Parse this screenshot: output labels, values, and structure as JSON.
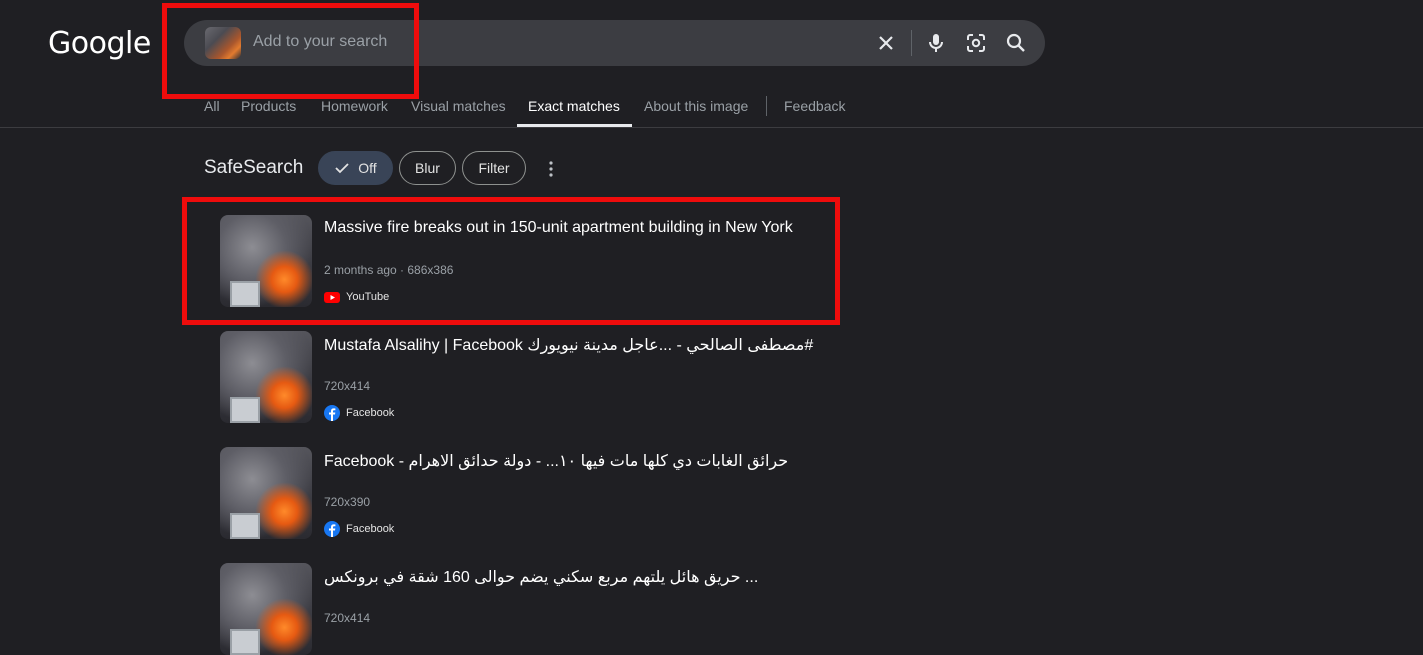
{
  "logo": "Google",
  "search": {
    "placeholder": "Add to your search"
  },
  "tabs": [
    {
      "label": "All"
    },
    {
      "label": "Products"
    },
    {
      "label": "Homework"
    },
    {
      "label": "Visual matches"
    },
    {
      "label": "Exact matches"
    },
    {
      "label": "About this image"
    },
    {
      "label": "Feedback"
    }
  ],
  "active_tab": "Exact matches",
  "safesearch": {
    "label": "SafeSearch",
    "options": [
      {
        "label": "Off",
        "selected": true
      },
      {
        "label": "Blur",
        "selected": false
      },
      {
        "label": "Filter",
        "selected": false
      }
    ]
  },
  "results": [
    {
      "title": "Massive fire breaks out in 150-unit apartment building in New York",
      "meta": "2 months ago · 686x386",
      "source": "YouTube",
      "source_icon": "youtube-icon"
    },
    {
      "title": "Mustafa Alsalihy | Facebook مصطفى الصالحي - ...عاجل مدينة نيويورك#",
      "meta": "720x414",
      "source": "Facebook",
      "source_icon": "facebook-icon"
    },
    {
      "title": "Facebook - حرائق الغابات دي كلها مات فيها ١٠... - دولة حدائق الاهرام",
      "meta": "720x390",
      "source": "Facebook",
      "source_icon": "facebook-icon"
    },
    {
      "title": "حريق هائل يلتهم مربع سكني يضم حوالى 160 شقة في برونكس ...",
      "meta": "720x414",
      "source": "",
      "source_icon": ""
    }
  ],
  "colors": {
    "highlight": "#ee0c0c",
    "youtube": "#ff0000",
    "facebook": "#1877f2"
  }
}
